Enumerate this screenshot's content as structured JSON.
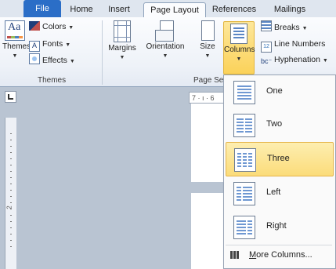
{
  "tabs": [
    {
      "label": "File"
    },
    {
      "label": "Home"
    },
    {
      "label": "Insert"
    },
    {
      "label": "Page Layout"
    },
    {
      "label": "References"
    },
    {
      "label": "Mailings"
    }
  ],
  "themes_group": {
    "themes_label": "Themes",
    "colors_label": "Colors",
    "fonts_label": "Fonts",
    "effects_label": "Effects",
    "group_label": "Themes"
  },
  "page_setup_group": {
    "margins_label": "Margins",
    "orientation_label": "Orientation",
    "size_label": "Size",
    "columns_label": "Columns",
    "breaks_label": "Breaks",
    "line_numbers_label": "Line Numbers",
    "hyphenation_label": "Hyphenation",
    "group_label": "Page Se"
  },
  "ruler_text": "7 · ı · 6",
  "columns_menu": {
    "items": [
      {
        "label": "One"
      },
      {
        "label": "Two"
      },
      {
        "label": "Three",
        "selected": true
      },
      {
        "label": "Left"
      },
      {
        "label": "Right"
      }
    ],
    "more_prefix": "M",
    "more_rest": "ore Columns..."
  },
  "colors": {
    "file_tab": "#2b6ec7",
    "highlight": "#fbd25a",
    "accent_blue": "#2e6fb7"
  }
}
